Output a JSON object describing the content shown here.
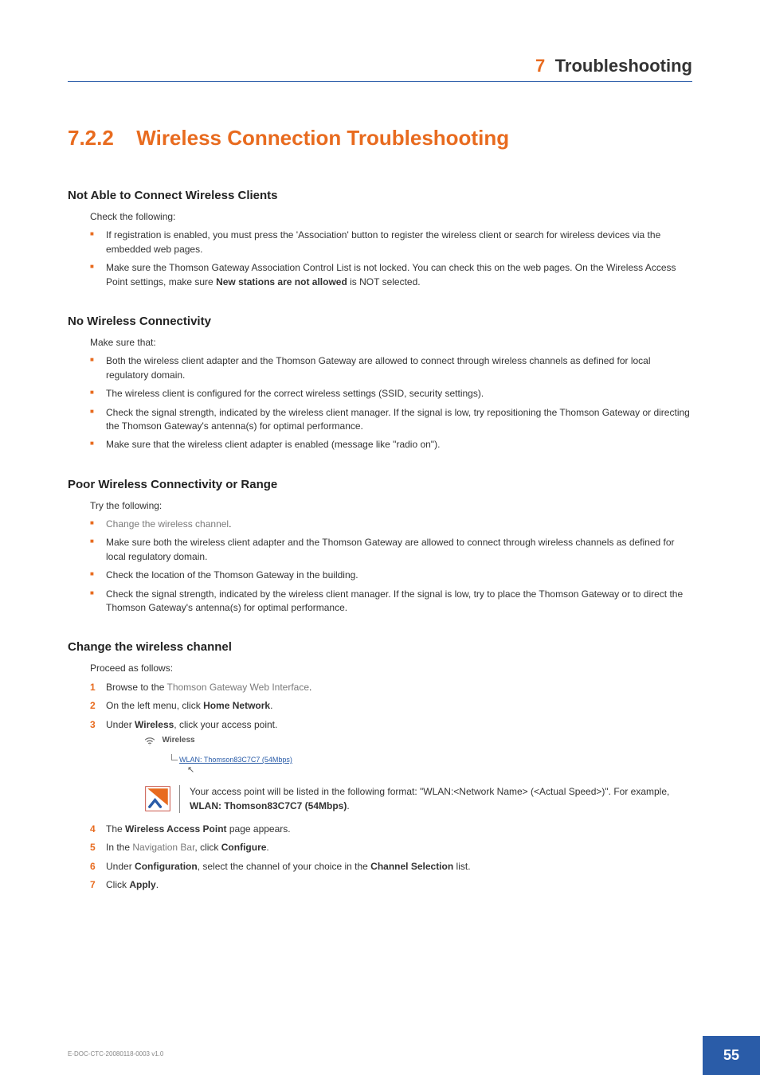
{
  "header": {
    "chapter_num": "7",
    "chapter_title": "Troubleshooting"
  },
  "section": {
    "num": "7.2.2",
    "name": "Wireless Connection Troubleshooting"
  },
  "s1": {
    "title": "Not Able to Connect Wireless Clients",
    "intro": "Check the following:",
    "b1": "If registration is enabled, you must press the 'Association' button to register the wireless client or search for wireless devices via the embedded web pages.",
    "b2a": "Make sure the Thomson Gateway Association Control List is not locked. You can check this on the web pages. On the Wireless Access Point settings, make sure ",
    "b2b": "New stations are not allowed",
    "b2c": " is NOT selected."
  },
  "s2": {
    "title": "No Wireless Connectivity",
    "intro": "Make sure that:",
    "b1": "Both the wireless client adapter and the Thomson Gateway are allowed to connect through wireless channels as defined for local regulatory domain.",
    "b2": "The wireless client is configured for the correct wireless settings (SSID, security settings).",
    "b3": "Check the signal strength, indicated by the wireless client manager. If the signal is low, try repositioning the Thomson Gateway or directing the Thomson Gateway's antenna(s) for optimal performance.",
    "b4": "Make sure that the wireless client adapter is enabled (message like \"radio on\")."
  },
  "s3": {
    "title": "Poor Wireless Connectivity or Range",
    "intro": "Try the following:",
    "b1": "Change the wireless channel",
    "b2": "Make sure both the wireless client adapter and the Thomson Gateway are allowed to connect through wireless channels as defined for local regulatory domain.",
    "b3": "Check the location of the Thomson Gateway in the building.",
    "b4": "Check the signal strength, indicated by the wireless client manager. If the signal is low, try to place the Thomson Gateway or to direct the Thomson Gateway's antenna(s) for optimal performance."
  },
  "s4": {
    "title": "Change the wireless channel",
    "intro": "Proceed as follows:",
    "st1a": "Browse to the ",
    "st1b": "Thomson Gateway Web Interface",
    "st2a": "On the left menu, click ",
    "st2b": "Home Network",
    "st3a": "Under ",
    "st3b": "Wireless",
    "st3c": ", click your access point.",
    "img_wireless": "Wireless",
    "img_wlan": "WLAN: Thomson83C7C7 (54Mbps)",
    "note_a": "Your access point will be listed in the following format: \"WLAN:<Network Name> (<Actual Speed>)\". For example, ",
    "note_b": "WLAN: Thomson83C7C7 (54Mbps)",
    "st4a": "The ",
    "st4b": "Wireless Access Point",
    "st4c": " page appears.",
    "st5a": "In the ",
    "st5b": "Navigation Bar",
    "st5c": ", click ",
    "st5d": "Configure",
    "st6a": "Under ",
    "st6b": "Configuration",
    "st6c": ", select the channel of your choice in the ",
    "st6d": "Channel Selection",
    "st6e": " list.",
    "st7a": "Click ",
    "st7b": "Apply"
  },
  "footer": {
    "doc": "E-DOC-CTC-20080118-0003 v1.0",
    "page": "55"
  }
}
